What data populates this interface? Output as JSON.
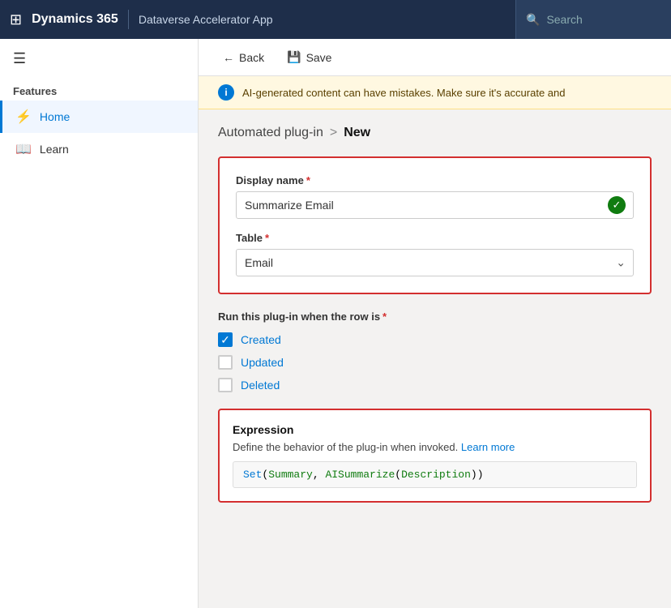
{
  "topnav": {
    "grid_icon": "⊞",
    "title": "Dynamics 365",
    "app_name": "Dataverse Accelerator App",
    "search_placeholder": "Search"
  },
  "sidebar": {
    "hamburger": "☰",
    "section_label": "Features",
    "items": [
      {
        "id": "home",
        "label": "Home",
        "icon": "⚡",
        "active": true
      },
      {
        "id": "learn",
        "label": "Learn",
        "icon": "📖",
        "active": false
      }
    ]
  },
  "toolbar": {
    "back_label": "Back",
    "save_label": "Save",
    "back_icon": "←",
    "save_icon": "💾"
  },
  "alert": {
    "icon": "i",
    "text": "AI-generated content can have mistakes. Make sure it's accurate and"
  },
  "breadcrumb": {
    "parent": "Automated plug-in",
    "separator": ">",
    "current": "New"
  },
  "form": {
    "display_name_label": "Display name",
    "display_name_required": "*",
    "display_name_value": "Summarize Email",
    "table_label": "Table",
    "table_required": "*",
    "table_value": "Email",
    "run_label": "Run this plug-in when the row is",
    "run_required": "*",
    "checkboxes": [
      {
        "id": "created",
        "label": "Created",
        "checked": true
      },
      {
        "id": "updated",
        "label": "Updated",
        "checked": false
      },
      {
        "id": "deleted",
        "label": "Deleted",
        "checked": false
      }
    ]
  },
  "expression": {
    "title": "Expression",
    "description": "Define the behavior of the plug-in when invoked.",
    "learn_more_label": "Learn more",
    "code_text": "Set(Summary, AISummarize(Description))"
  }
}
